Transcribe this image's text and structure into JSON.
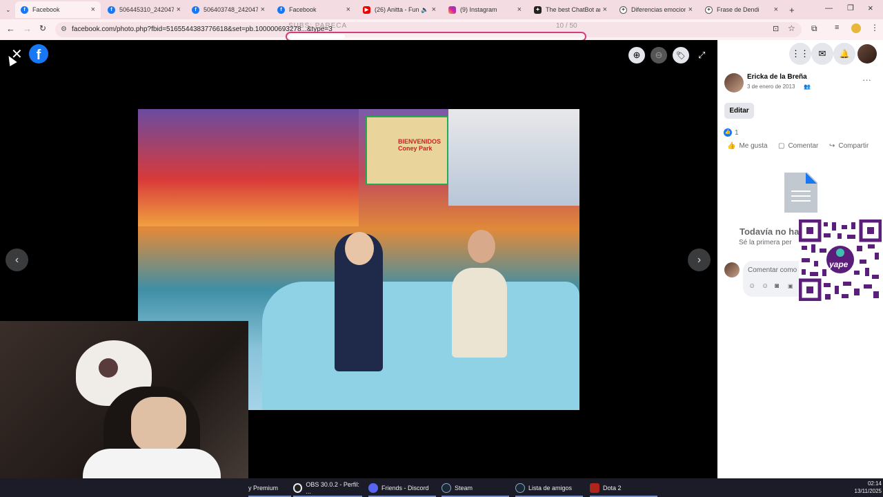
{
  "browser": {
    "tabs": [
      {
        "label": "Facebook",
        "favicon": "facebook-icon",
        "active": true
      },
      {
        "label": "506445310_2420475...",
        "favicon": "facebook-icon"
      },
      {
        "label": "506403748_2420475...",
        "favicon": "facebook-icon"
      },
      {
        "label": "Facebook",
        "favicon": "facebook-icon"
      },
      {
        "label": "(26) Anitta - Funk...",
        "favicon": "youtube-icon"
      },
      {
        "label": "(9) Instagram",
        "favicon": "instagram-icon"
      },
      {
        "label": "The best ChatBot an...",
        "favicon": "chatgpt-icon"
      },
      {
        "label": "Diferencias emocion...",
        "favicon": "chatgpt-icon"
      },
      {
        "label": "Frase de Dendi",
        "favicon": "chatgpt-icon"
      }
    ],
    "url": "facebook.com/photo.php?fbid=5165544383776618&set=pb.100000693278...&type=3",
    "overlay_text": "SUBS: PARECA",
    "overlay_counter": "10 / 50"
  },
  "viewer": {
    "photo_sign": "BIENVENIDOS Coney Park"
  },
  "sidebar": {
    "author": "Ericka de la Breña",
    "date": "3 de enero de 2013",
    "edit_label": "Editar",
    "like_count": "1",
    "actions": {
      "like": "Me gusta",
      "comment": "Comentar",
      "share": "Compartir"
    },
    "empty_title": "Todavía no ha",
    "empty_sub": "Sé la primera per",
    "comment_placeholder": "Comentar como"
  },
  "qr": {
    "brand": "yape"
  },
  "taskbar": {
    "items": [
      {
        "label": "y Premium",
        "icon": "youtube-icon"
      },
      {
        "label": "OBS 30.0.2 - Perfil: ...",
        "icon": "obs-icon"
      },
      {
        "label": "Friends - Discord",
        "icon": "discord-icon"
      },
      {
        "label": "Steam",
        "icon": "steam-icon"
      },
      {
        "label": "Lista de amigos",
        "icon": "steam-icon"
      },
      {
        "label": "Dota 2",
        "icon": "dota-icon"
      }
    ],
    "time": "02:14",
    "date": "13/11/2025"
  },
  "colors": {
    "facebook_blue": "#1877f2",
    "tabbar": "#f3dde2",
    "yape_purple": "#5b1e7a"
  }
}
